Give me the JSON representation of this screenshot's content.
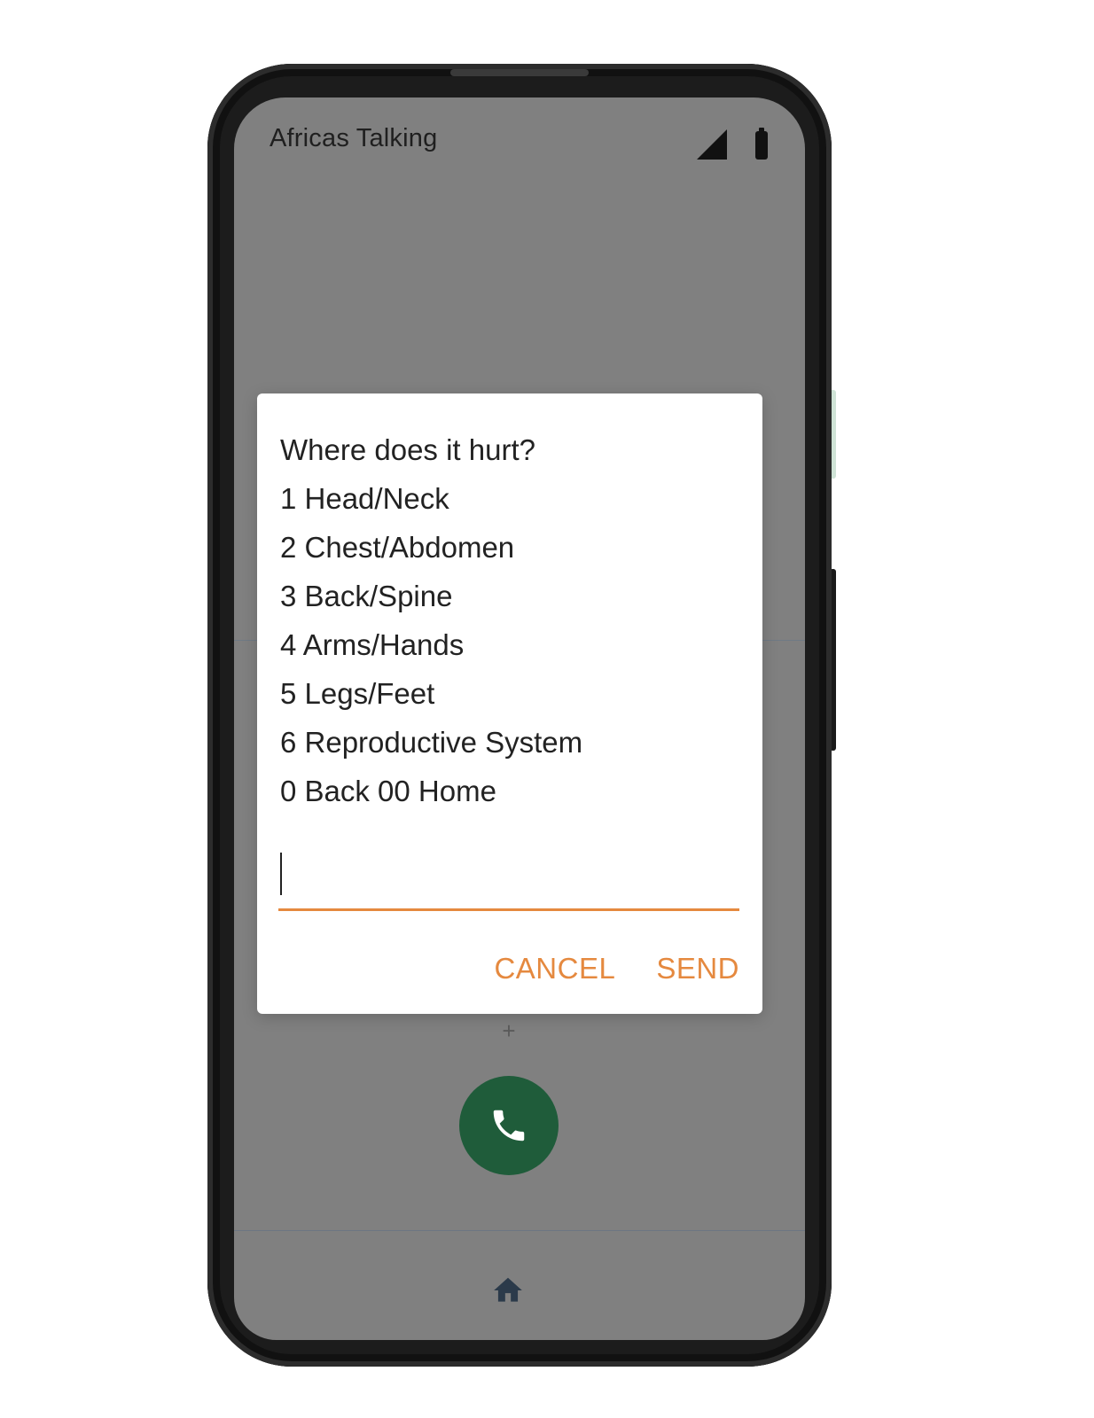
{
  "status_bar": {
    "app_title": "Africas Talking",
    "signal_icon": "cell-signal-icon",
    "battery_icon": "battery-icon"
  },
  "dialog": {
    "message_lines": [
      "Where does it hurt?",
      "1 Head/Neck",
      "2 Chest/Abdomen",
      "3 Back/Spine",
      "4 Arms/Hands",
      "5 Legs/Feet",
      "6 Reproductive System",
      "0 Back 00 Home"
    ],
    "input_value": "",
    "cancel_label": "CANCEL",
    "send_label": "SEND"
  },
  "background": {
    "plus_glyph": "+",
    "call_icon": "phone-icon",
    "home_icon": "home-icon"
  },
  "colors": {
    "accent": "#e5893f",
    "call_button": "#1f5c3a",
    "scrim": "#808080"
  }
}
